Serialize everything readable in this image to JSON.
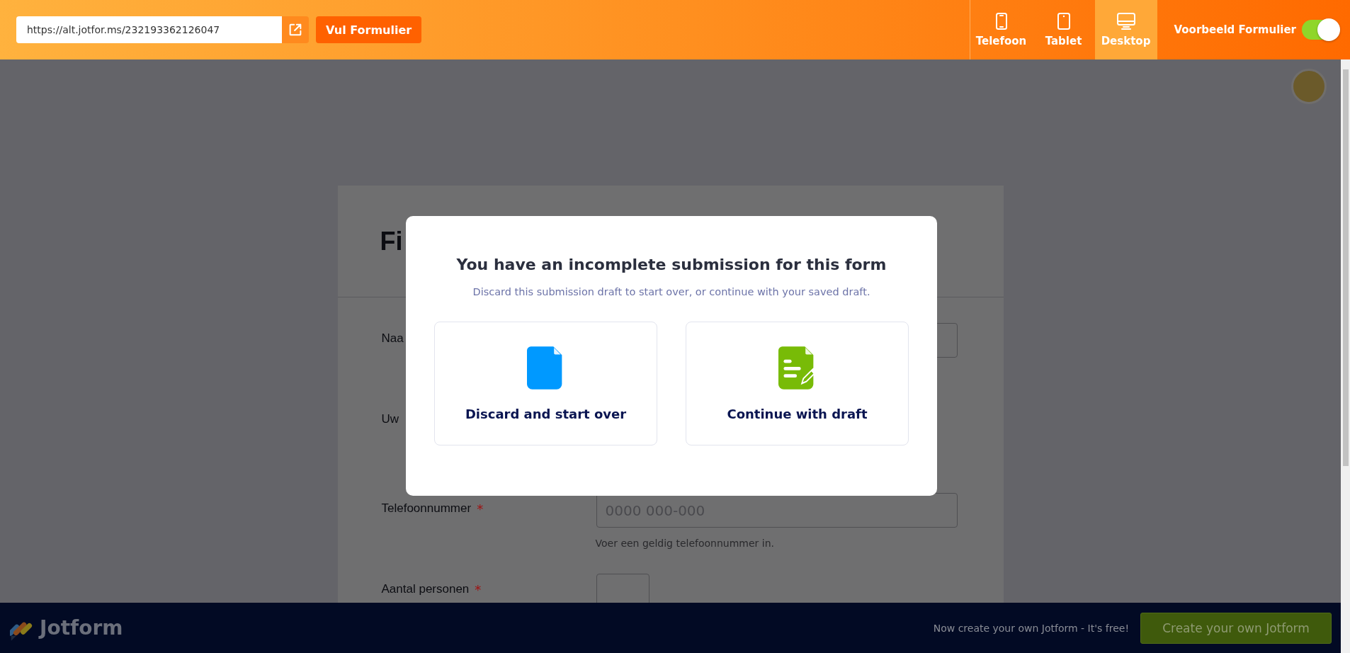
{
  "toolbar": {
    "url": "https://alt.jotfor.ms/232193362126047",
    "fill_button": "Vul Formulier",
    "devices": [
      {
        "label": "Telefoon",
        "kind": "phone",
        "selected": false
      },
      {
        "label": "Tablet",
        "kind": "tablet",
        "selected": false
      },
      {
        "label": "Desktop",
        "kind": "desktop",
        "selected": true
      }
    ],
    "preview_toggle": {
      "label": "Voorbeeld Formulier",
      "on": true
    }
  },
  "form": {
    "title": "Fi",
    "fields": [
      {
        "label": "Naa",
        "kind": "text"
      },
      {
        "label": "Uw",
        "kind": "label"
      },
      {
        "label": "Telefoonnummer",
        "kind": "text",
        "required_mark": "*",
        "placeholder": "0000 000-000",
        "hint": "Voer een geldig telefoonnummer in."
      },
      {
        "label": "Aantal personen",
        "kind": "number",
        "required_mark": "*"
      }
    ]
  },
  "dialog": {
    "title": "You have an incomplete submission for this form",
    "message": "Discard this submission draft to start over, or continue with your saved draft.",
    "options": [
      {
        "label": "Discard and start over",
        "kind": "discard"
      },
      {
        "label": "Continue with draft",
        "kind": "continue"
      }
    ]
  },
  "footer": {
    "brand": "Jotform",
    "promo": "Now create your own Jotform - It's free!",
    "button": "Create your own Jotform"
  }
}
